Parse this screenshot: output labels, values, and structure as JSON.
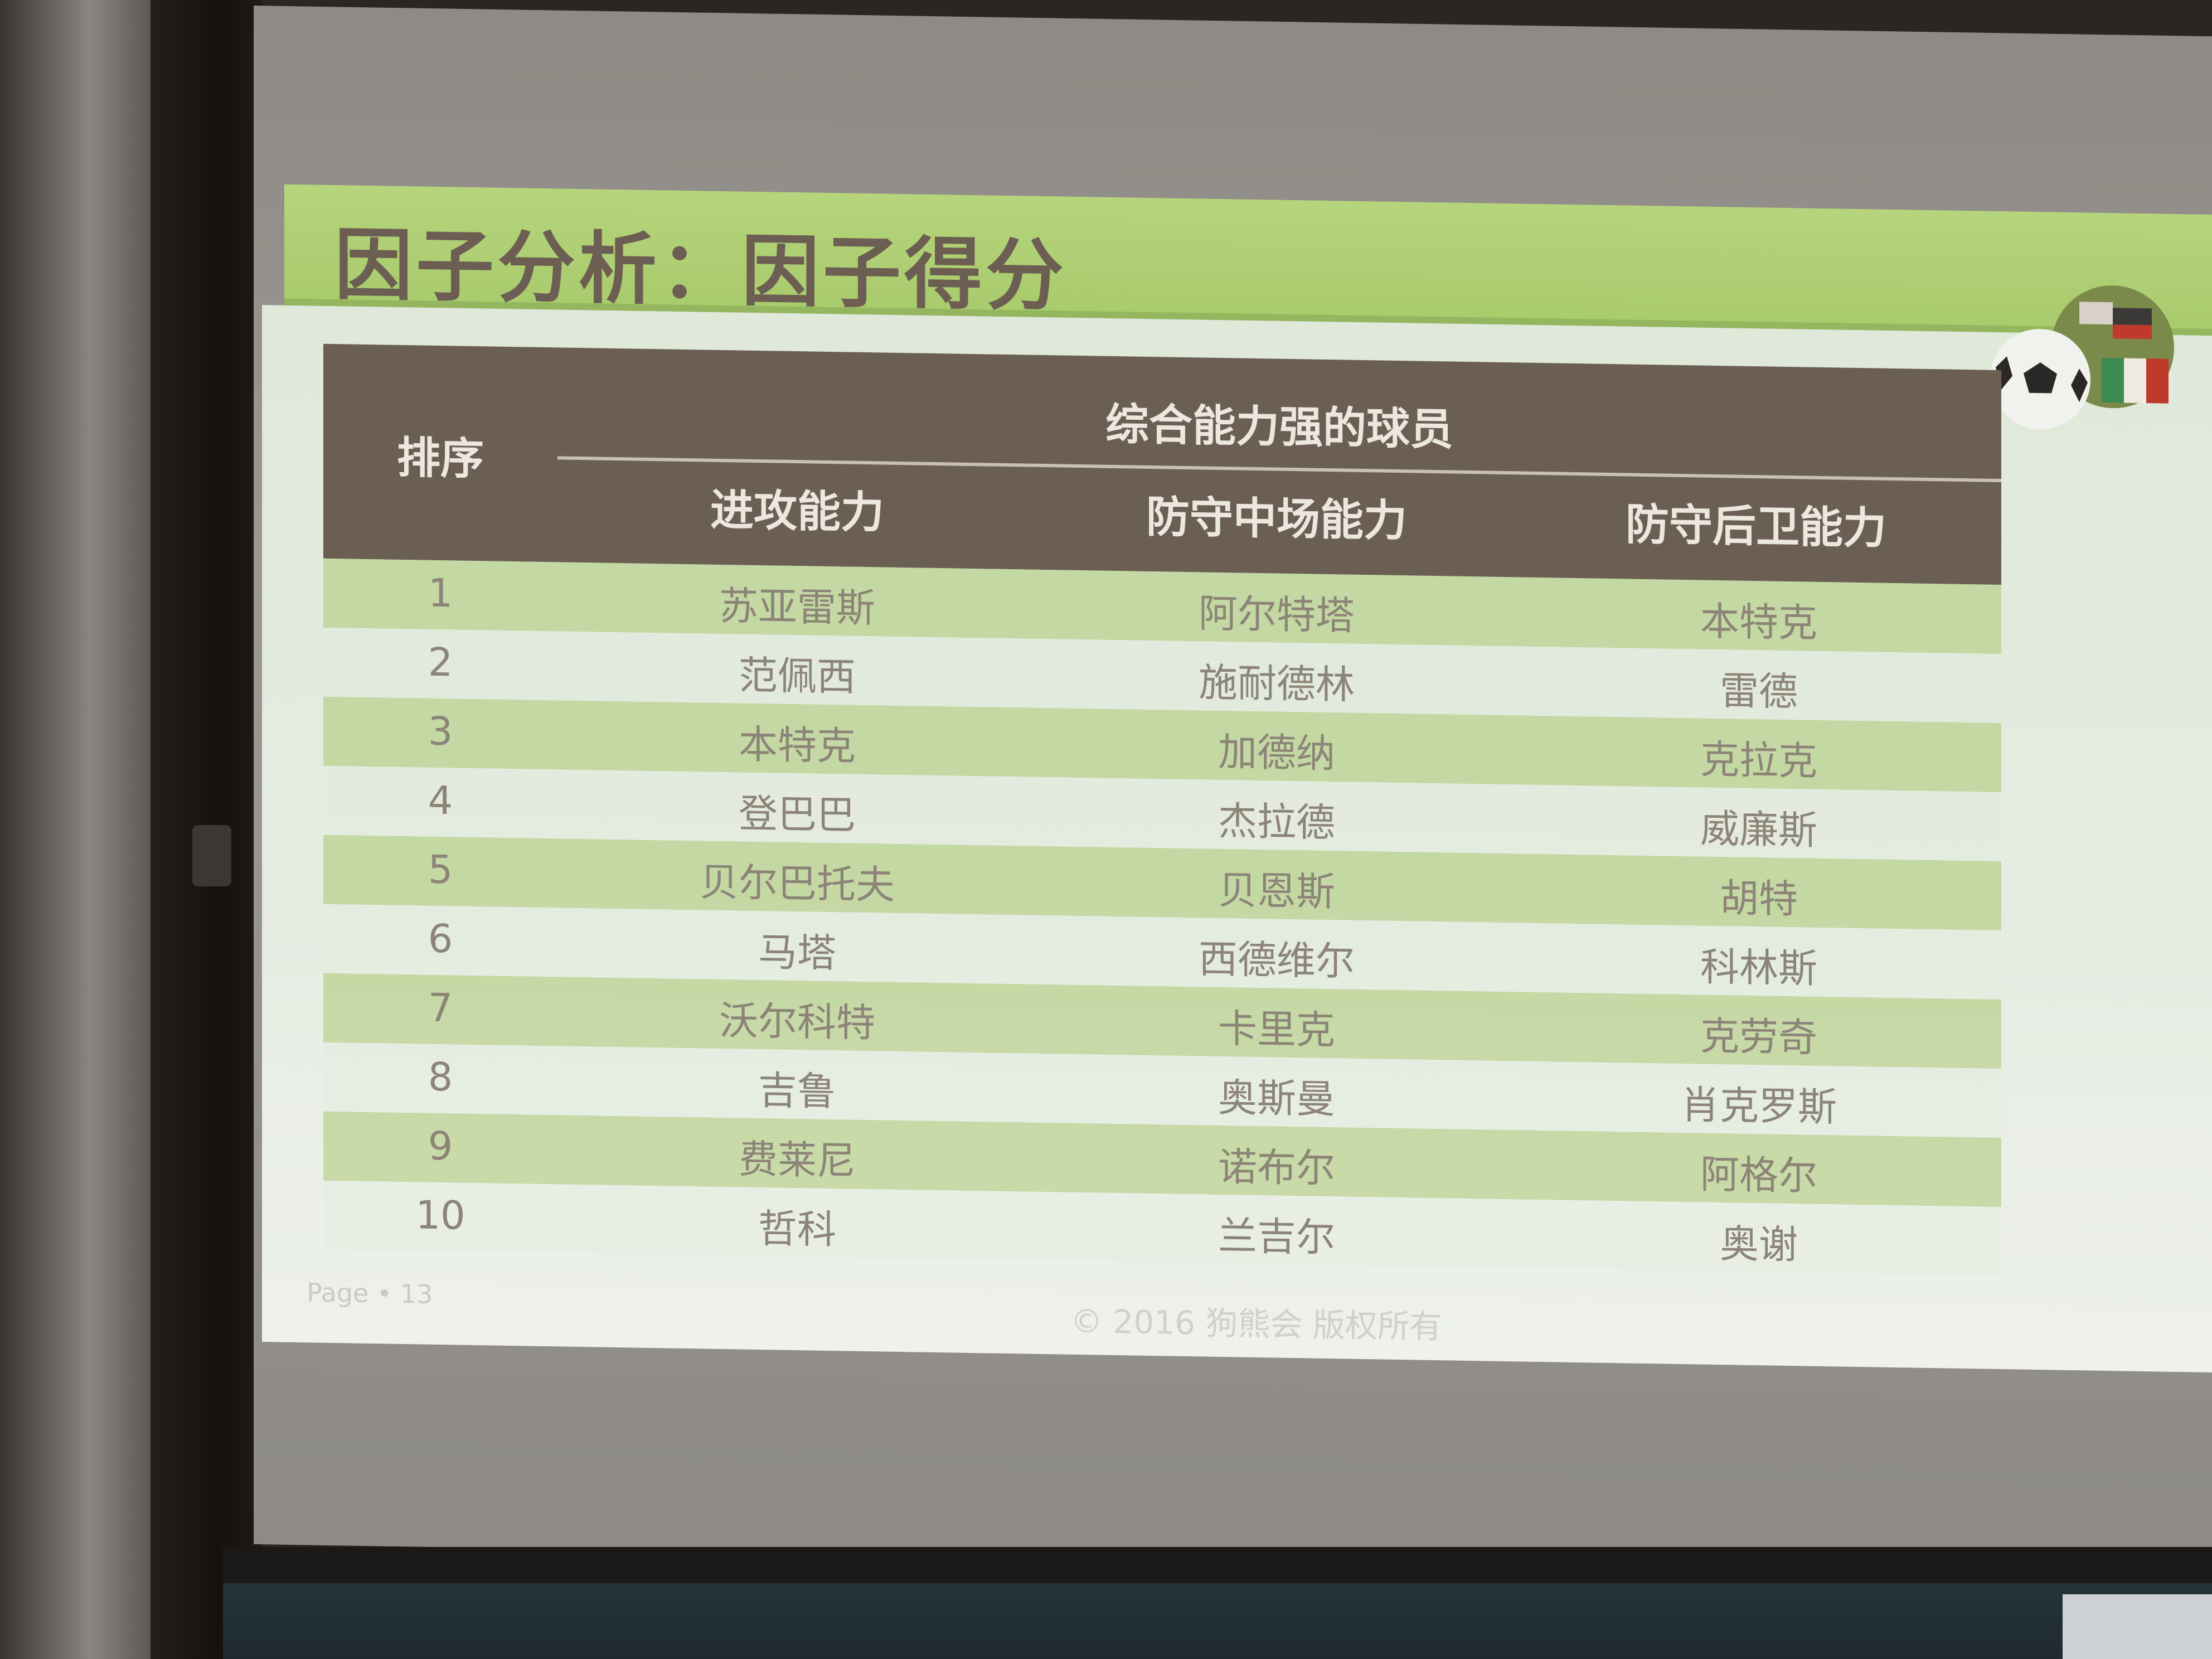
{
  "slide": {
    "title": "因子分析：因子得分",
    "page": "Page • 13",
    "copyright": "© 2016 狗熊会 版权所有"
  },
  "table": {
    "rank_header": "排序",
    "group_header": "综合能力强的球员",
    "columns": [
      "进攻能力",
      "防守中场能力",
      "防守后卫能力"
    ],
    "rows": [
      {
        "rank": "1",
        "attack": "苏亚雷斯",
        "midfield": "阿尔特塔",
        "defense": "本特克"
      },
      {
        "rank": "2",
        "attack": "范佩西",
        "midfield": "施耐德林",
        "defense": "雷德"
      },
      {
        "rank": "3",
        "attack": "本特克",
        "midfield": "加德纳",
        "defense": "克拉克"
      },
      {
        "rank": "4",
        "attack": "登巴巴",
        "midfield": "杰拉德",
        "defense": "威廉斯"
      },
      {
        "rank": "5",
        "attack": "贝尔巴托夫",
        "midfield": "贝恩斯",
        "defense": "胡特"
      },
      {
        "rank": "6",
        "attack": "马塔",
        "midfield": "西德维尔",
        "defense": "科林斯"
      },
      {
        "rank": "7",
        "attack": "沃尔科特",
        "midfield": "卡里克",
        "defense": "克劳奇"
      },
      {
        "rank": "8",
        "attack": "吉鲁",
        "midfield": "奥斯曼",
        "defense": "肖克罗斯"
      },
      {
        "rank": "9",
        "attack": "费莱尼",
        "midfield": "诺布尔",
        "defense": "阿格尔"
      },
      {
        "rank": "10",
        "attack": "哲科",
        "midfield": "兰吉尔",
        "defense": "奥谢"
      }
    ]
  },
  "colors": {
    "title_band": "#b6d47c",
    "header_bg": "#6b5f54",
    "row_stripe": "#aac973"
  },
  "icons": [
    "soccer-ball-icon",
    "flag-globe-icon"
  ]
}
